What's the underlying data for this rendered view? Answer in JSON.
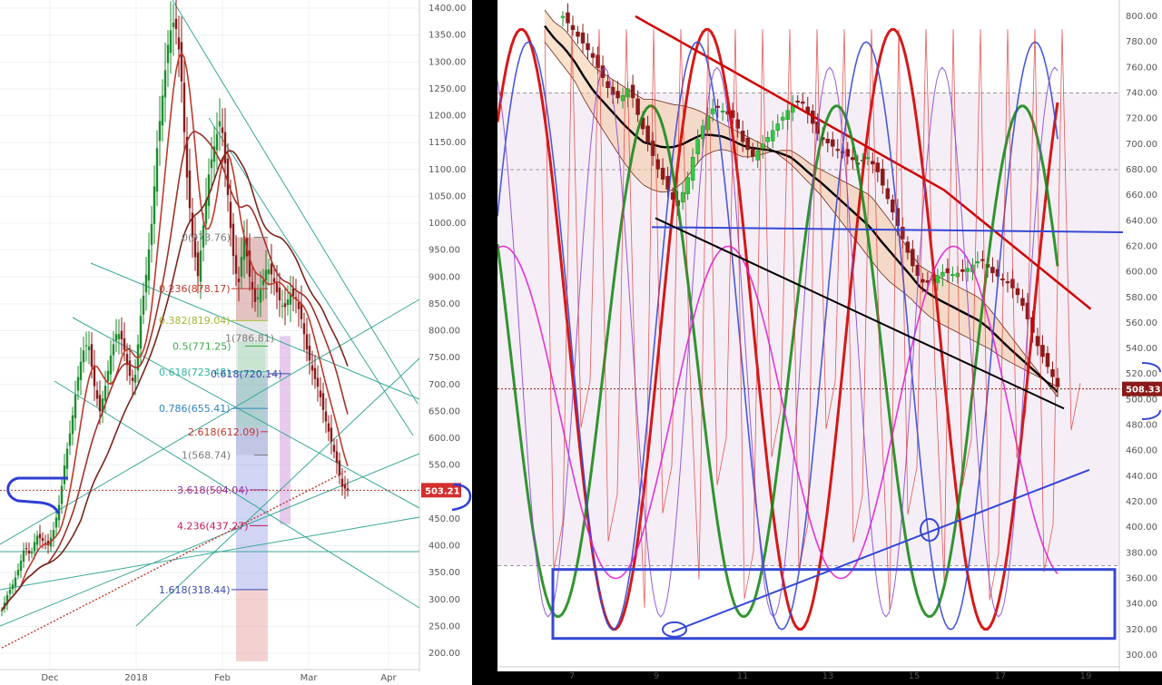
{
  "chart_data": [
    {
      "type": "candlestick",
      "title": "",
      "ylim": [
        185,
        1420
      ],
      "y_ticks": [
        "1400.00",
        "1350.00",
        "1300.00",
        "1250.00",
        "1200.00",
        "1150.00",
        "1100.00",
        "1050.00",
        "1000.00",
        "950.00",
        "900.00",
        "850.00",
        "800.00",
        "750.00",
        "700.00",
        "650.00",
        "600.00",
        "550.00",
        "500.00",
        "450.00",
        "400.00",
        "350.00",
        "300.00",
        "250.00",
        "200.00"
      ],
      "x_ticks": [
        "Dec",
        "2018",
        "Feb",
        "Mar",
        "Apr"
      ],
      "last_price_label": "503.21",
      "grid": true,
      "close_series": [
        280,
        310,
        330,
        360,
        400,
        380,
        420,
        410,
        400,
        430,
        480,
        560,
        620,
        700,
        760,
        780,
        700,
        650,
        700,
        760,
        800,
        780,
        720,
        700,
        820,
        900,
        1000,
        1150,
        1250,
        1350,
        1380,
        1300,
        1100,
        980,
        900,
        1000,
        1100,
        1150,
        1200,
        1080,
        950,
        880,
        980,
        900,
        850,
        880,
        920,
        900,
        860,
        840,
        870,
        860,
        820,
        760,
        720,
        690,
        640,
        600,
        560,
        510,
        503
      ],
      "fibonacci": [
        {
          "label": "0(973.76)",
          "value": 973.76,
          "color": "#7a7a7a"
        },
        {
          "label": "0.236(878.17)",
          "value": 878.17,
          "color": "#c0392b"
        },
        {
          "label": "0.382(819.04)",
          "value": 819.04,
          "color": "#a7b62e"
        },
        {
          "label": "0.5(771.25)",
          "value": 771.25,
          "color": "#3daa49"
        },
        {
          "label": "0.618(723.48)",
          "value": 723.48,
          "color": "#2bb6a0"
        },
        {
          "label": "0.786(655.41)",
          "value": 655.41,
          "color": "#2e86c1"
        },
        {
          "label": "1(568.74)",
          "value": 568.74,
          "color": "#7a7a7a"
        },
        {
          "label": "1.618(318.44)",
          "value": 318.44,
          "color": "#3949ab"
        },
        {
          "label": "2.618(612.09)",
          "value": 612.09,
          "color": "#c0392b"
        },
        {
          "label": "3.618(504.04)",
          "value": 504.04,
          "color": "#8e2fa8"
        },
        {
          "label": "4.236(437.27)",
          "value": 437.27,
          "color": "#c2185b"
        }
      ],
      "annotations": [
        "1(786.81)",
        "0.618(720.14)"
      ]
    },
    {
      "type": "candlestick",
      "title": "",
      "ylim": [
        290,
        810
      ],
      "y_ticks": [
        "800.00",
        "780.00",
        "760.00",
        "740.00",
        "720.00",
        "700.00",
        "680.00",
        "660.00",
        "640.00",
        "620.00",
        "600.00",
        "580.00",
        "560.00",
        "540.00",
        "520.00",
        "500.00",
        "480.00",
        "460.00",
        "440.00",
        "420.00",
        "400.00",
        "380.00",
        "360.00",
        "340.00",
        "320.00",
        "300.00"
      ],
      "x_ticks": [
        "7",
        "9",
        "11",
        "13",
        "15",
        "17",
        "19"
      ],
      "last_price_label": "508.33",
      "grid": false,
      "close_series": [
        800,
        790,
        780,
        770,
        755,
        740,
        735,
        745,
        720,
        700,
        680,
        665,
        650,
        670,
        700,
        720,
        730,
        725,
        720,
        700,
        690,
        700,
        710,
        720,
        730,
        735,
        720,
        705,
        700,
        695,
        690,
        685,
        690,
        680,
        660,
        640,
        620,
        600,
        590,
        595,
        600,
        598,
        600,
        605,
        610,
        600,
        595,
        590,
        580,
        560,
        540,
        525,
        510
      ],
      "upper_band": [
        805,
        795,
        790,
        780,
        770,
        760,
        755,
        750,
        745,
        740,
        735,
        735,
        733,
        731,
        730,
        728,
        725,
        720,
        716,
        712,
        708,
        704,
        700,
        696,
        690,
        684,
        676,
        668,
        660,
        650,
        640,
        630,
        620,
        610,
        600,
        592,
        586,
        580,
        572,
        565,
        560,
        556,
        552,
        548,
        544,
        540,
        535,
        530,
        526,
        522,
        518,
        514,
        510
      ],
      "lower_band": [
        780,
        770,
        760,
        750,
        735,
        722,
        710,
        698,
        686,
        676,
        668,
        664,
        662,
        664,
        670,
        680,
        690,
        694,
        696,
        694,
        690,
        690,
        692,
        694,
        695,
        695,
        690,
        684,
        680,
        676,
        672,
        668,
        664,
        660,
        650,
        640,
        628,
        616,
        605,
        600,
        596,
        592,
        588,
        584,
        580,
        572,
        562,
        552,
        542,
        532,
        522,
        512,
        502
      ]
    }
  ]
}
